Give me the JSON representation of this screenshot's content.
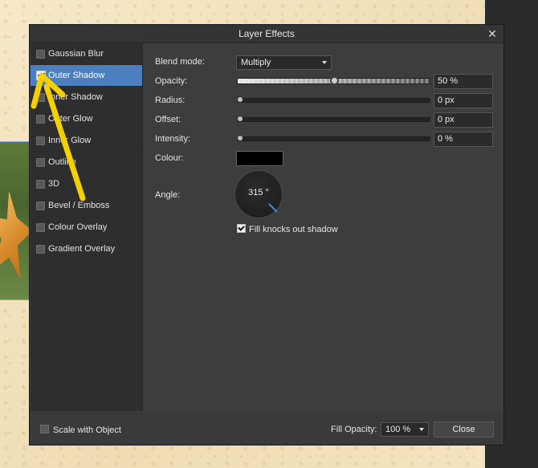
{
  "dialog": {
    "title": "Layer Effects",
    "close_glyph": "✕"
  },
  "sidebar": {
    "items": [
      {
        "label": "Gaussian Blur",
        "checked": false
      },
      {
        "label": "Outer Shadow",
        "checked": true,
        "selected": true
      },
      {
        "label": "Inner Shadow",
        "checked": false
      },
      {
        "label": "Outer Glow",
        "checked": false
      },
      {
        "label": "Inner Glow",
        "checked": false
      },
      {
        "label": "Outline",
        "checked": false
      },
      {
        "label": "3D",
        "checked": false
      },
      {
        "label": "Bevel / Emboss",
        "checked": false
      },
      {
        "label": "Colour Overlay",
        "checked": false
      },
      {
        "label": "Gradient Overlay",
        "checked": false
      }
    ]
  },
  "settings": {
    "blend_mode": {
      "label": "Blend mode:",
      "value": "Multiply"
    },
    "opacity": {
      "label": "Opacity:",
      "value": "50 %",
      "level": 0.5
    },
    "radius": {
      "label": "Radius:",
      "value": "0 px",
      "level": 0
    },
    "offset": {
      "label": "Offset:",
      "value": "0 px",
      "level": 0
    },
    "intensity": {
      "label": "Intensity:",
      "value": "0 %",
      "level": 0
    },
    "colour": {
      "label": "Colour:",
      "value_hex": "#000000"
    },
    "angle": {
      "label": "Angle:",
      "value": "315 °"
    },
    "fill_knocks_out": {
      "label": "Fill knocks out shadow",
      "checked": true
    }
  },
  "footer": {
    "scale_with_object": {
      "label": "Scale with Object",
      "checked": false
    },
    "fill_opacity": {
      "label": "Fill Opacity:",
      "value": "100 %"
    },
    "close_label": "Close"
  },
  "colors": {
    "accent": "#4b7fc0",
    "annotation_arrow": "#f5d000",
    "dialog_bg": "#3d3d3d"
  },
  "icons": {
    "close": "close-icon",
    "dropdown": "chevron-down-icon",
    "annotation": "arrow-annotation-icon"
  }
}
